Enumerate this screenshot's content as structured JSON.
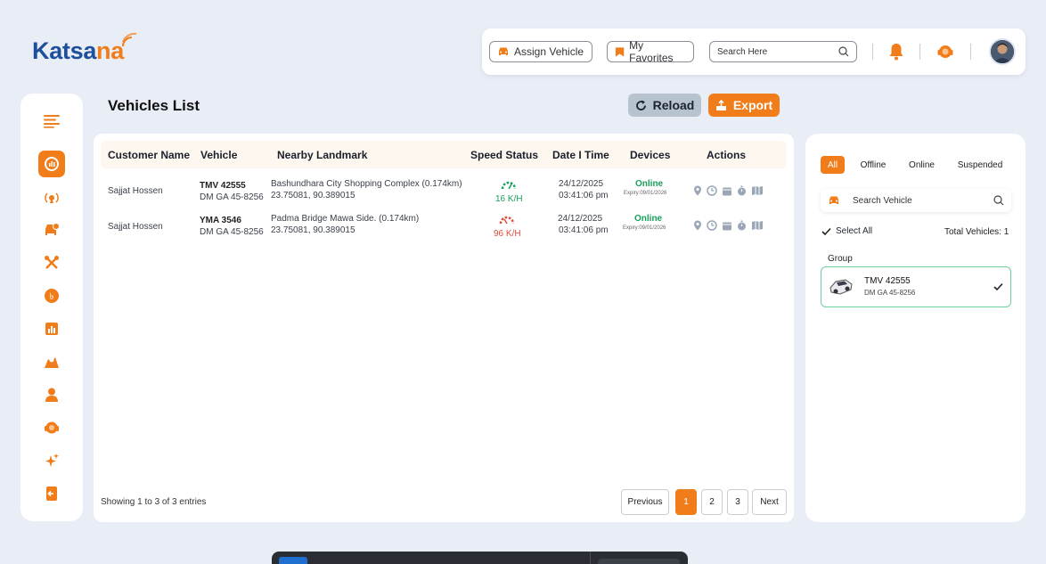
{
  "brand": {
    "logo_text_a": "Katsa",
    "logo_text_b": "na"
  },
  "topbar": {
    "assign_vehicle": "Assign Vehicle",
    "my_favorites": "My Favorites",
    "search_placeholder": "Search Here"
  },
  "page": {
    "title": "Vehicles List",
    "reload": "Reload",
    "export": "Export"
  },
  "table": {
    "headers": [
      "Customer Name",
      "Vehicle",
      "Nearby Landmark",
      "Speed Status",
      "Date I Time",
      "Devices",
      "Actions"
    ],
    "rows": [
      {
        "customer": "Sajjat Hossen",
        "vehicle": "TMV 42555",
        "plate": "DM GA 45-8256",
        "landmark": "Bashundhara City Shopping Complex (0.174km)",
        "coords": "23.75081, 90.389015",
        "speed": "16 K/H",
        "date": "24/12/2025",
        "time": "03:41:06 pm",
        "status": "Online",
        "expiry": "Expiry:09/01/2026"
      },
      {
        "customer": "Sajjat Hossen",
        "vehicle": "YMA 3546",
        "plate": "DM GA 45-8256",
        "landmark": "Padma Bridge Mawa Side. (0.174km)",
        "coords": "23.75081, 90.389015",
        "speed": "96 K/H",
        "date": "24/12/2025",
        "time": "03:41:06 pm",
        "status": "Online",
        "expiry": "Expiry:09/01/2026"
      }
    ],
    "footer": "Showing 1 to 3 of 3 entries",
    "pagination": {
      "previous": "Previous",
      "pages": [
        "1",
        "2",
        "3"
      ],
      "next": "Next"
    }
  },
  "right_panel": {
    "filters": [
      "All",
      "Offline",
      "Online",
      "Suspended"
    ],
    "search_placeholder": "Search Vehicle",
    "select_all": "Select All",
    "total_vehicles": "Total Vehicles: 1",
    "group_label": "Group",
    "vehicle": {
      "name": "TMV 42555",
      "plate": "DM GA 45-8256"
    }
  },
  "colors": {
    "accent": "#f07d1a",
    "brand": "#1e4f9c",
    "online": "#18a05a",
    "danger": "#e34b3a"
  }
}
